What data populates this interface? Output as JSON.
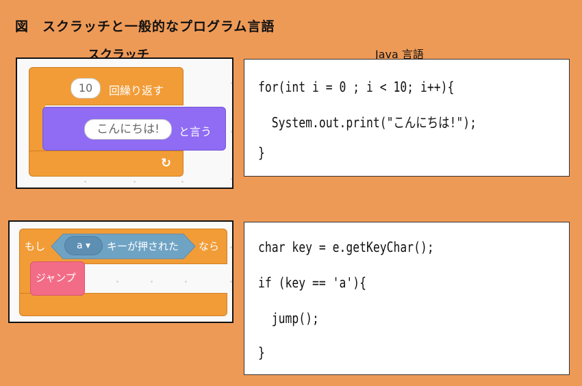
{
  "figure_title": "図　スクラッチと一般的なプログラム言語",
  "scratch_label": "スクラッチ",
  "java_label": "Java 言語",
  "example1": {
    "repeat_count": "10",
    "repeat_label": "回繰り返す",
    "say_value": "こんにちは!",
    "say_label": "と言う",
    "loop_arrow": "↻",
    "code": [
      "for(int i = 0 ; i < 10; i++){",
      "  System.out.print(\"こんにちは!\");",
      "}"
    ]
  },
  "example2": {
    "if_label": "もし",
    "key_value": "a ▾",
    "key_pressed_label": "キーが押された",
    "then_label": "なら",
    "jump_label": "ジャンプ",
    "code": [
      "char key = e.getKeyChar();",
      "if (key == 'a'){",
      "  jump();",
      "}"
    ]
  },
  "colors": {
    "background": "#ee9a57",
    "control": "#f29c37",
    "looks": "#8f6cf3",
    "sensing": "#6fa3c4",
    "custom": "#f36c87"
  }
}
